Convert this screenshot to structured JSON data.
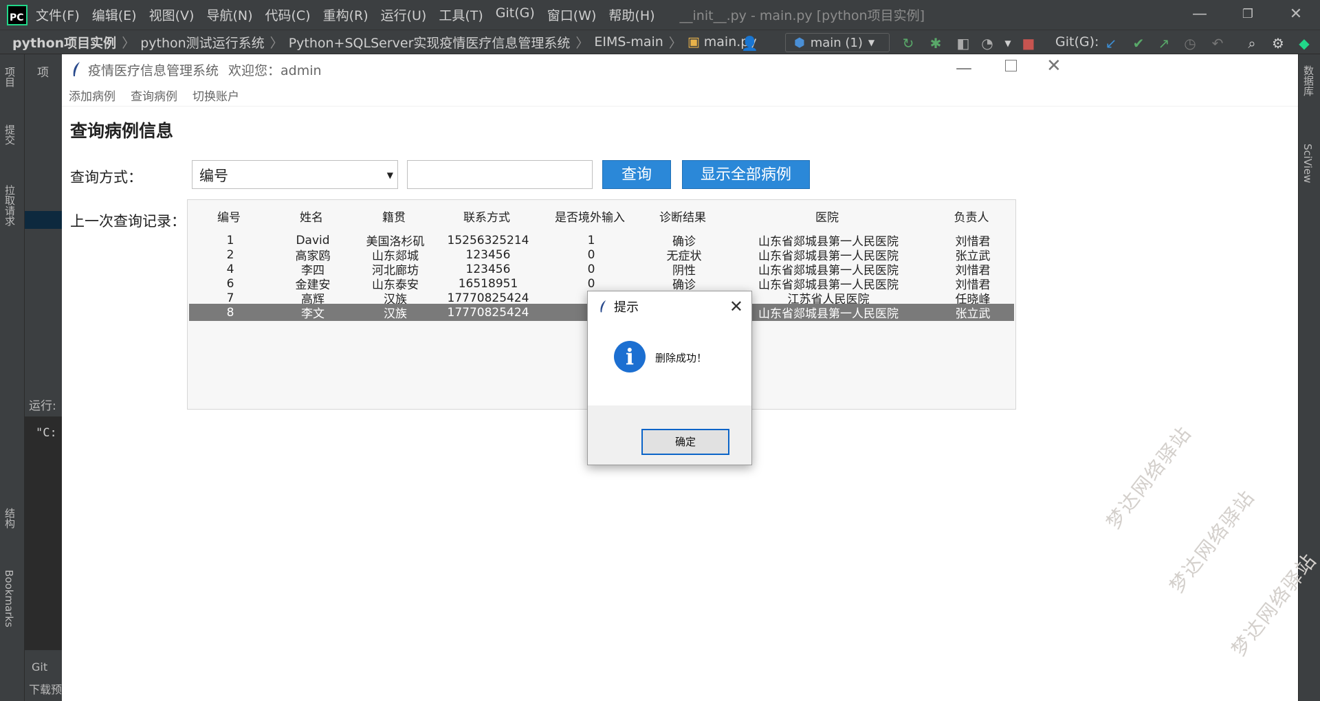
{
  "ide": {
    "menus": [
      "文件(F)",
      "编辑(E)",
      "视图(V)",
      "导航(N)",
      "代码(C)",
      "重构(R)",
      "运行(U)",
      "工具(T)",
      "Git(G)",
      "窗口(W)",
      "帮助(H)"
    ],
    "window_title": "__init__.py - main.py [python项目实例]",
    "breadcrumbs": [
      "python项目实例",
      "python测试运行系统",
      "Python+SQLServer实现疫情医疗信息管理系统",
      "EIMS-main"
    ],
    "current_file": "main.py",
    "branch": "main (1)",
    "git_label": "Git(G):",
    "left_tabs": [
      "项目",
      "提交",
      "拉取请求",
      "结构",
      "Bookmarks"
    ],
    "right_tabs": [
      "数据库",
      "SciView"
    ],
    "run_label": "运行:",
    "console_text": "\"C:",
    "bottom_tabs": [
      "Git",
      "下载预"
    ],
    "project_tab": "项"
  },
  "app": {
    "title": "疫情医疗信息管理系统",
    "welcome": "欢迎您：admin",
    "menu": [
      "添加病例",
      "查询病例",
      "切换账户"
    ],
    "heading": "查询病例信息",
    "query_label": "查询方式：",
    "query_mode": "编号",
    "query_input": "",
    "query_button": "查询",
    "show_all_button": "显示全部病例",
    "last_record_label": "上一次查询记录：",
    "table": {
      "headers": [
        "编号",
        "姓名",
        "籍贯",
        "联系方式",
        "是否境外输入",
        "诊断结果",
        "医院",
        "负责人"
      ],
      "rows": [
        [
          "1",
          "David",
          "美国洛杉矶",
          "15256325214",
          "1",
          "确诊",
          "山东省郯城县第一人民医院",
          "刘惜君"
        ],
        [
          "2",
          "高家鸥",
          "山东郯城",
          "123456",
          "0",
          "无症状",
          "山东省郯城县第一人民医院",
          "张立武"
        ],
        [
          "4",
          "李四",
          "河北廊坊",
          "123456",
          "0",
          "阴性",
          "山东省郯城县第一人民医院",
          "刘惜君"
        ],
        [
          "6",
          "金建安",
          "山东泰安",
          "16518951",
          "0",
          "确诊",
          "山东省郯城县第一人民医院",
          "刘惜君"
        ],
        [
          "7",
          "高辉",
          "汉族",
          "17770825424",
          "",
          "",
          "江苏省人民医院",
          "任晓峰"
        ],
        [
          "8",
          "李文",
          "汉族",
          "17770825424",
          "",
          "",
          "山东省郯城县第一人民医院",
          "张立武"
        ]
      ],
      "selected_row": 5
    }
  },
  "dialog": {
    "title": "提示",
    "message": "删除成功！",
    "ok_button": "确定"
  },
  "watermark": "梦达网络驿站",
  "colors": {
    "ide_bg": "#3c3f41",
    "accent_blue": "#2b88d8",
    "selected_row": "#7a7a7a"
  }
}
